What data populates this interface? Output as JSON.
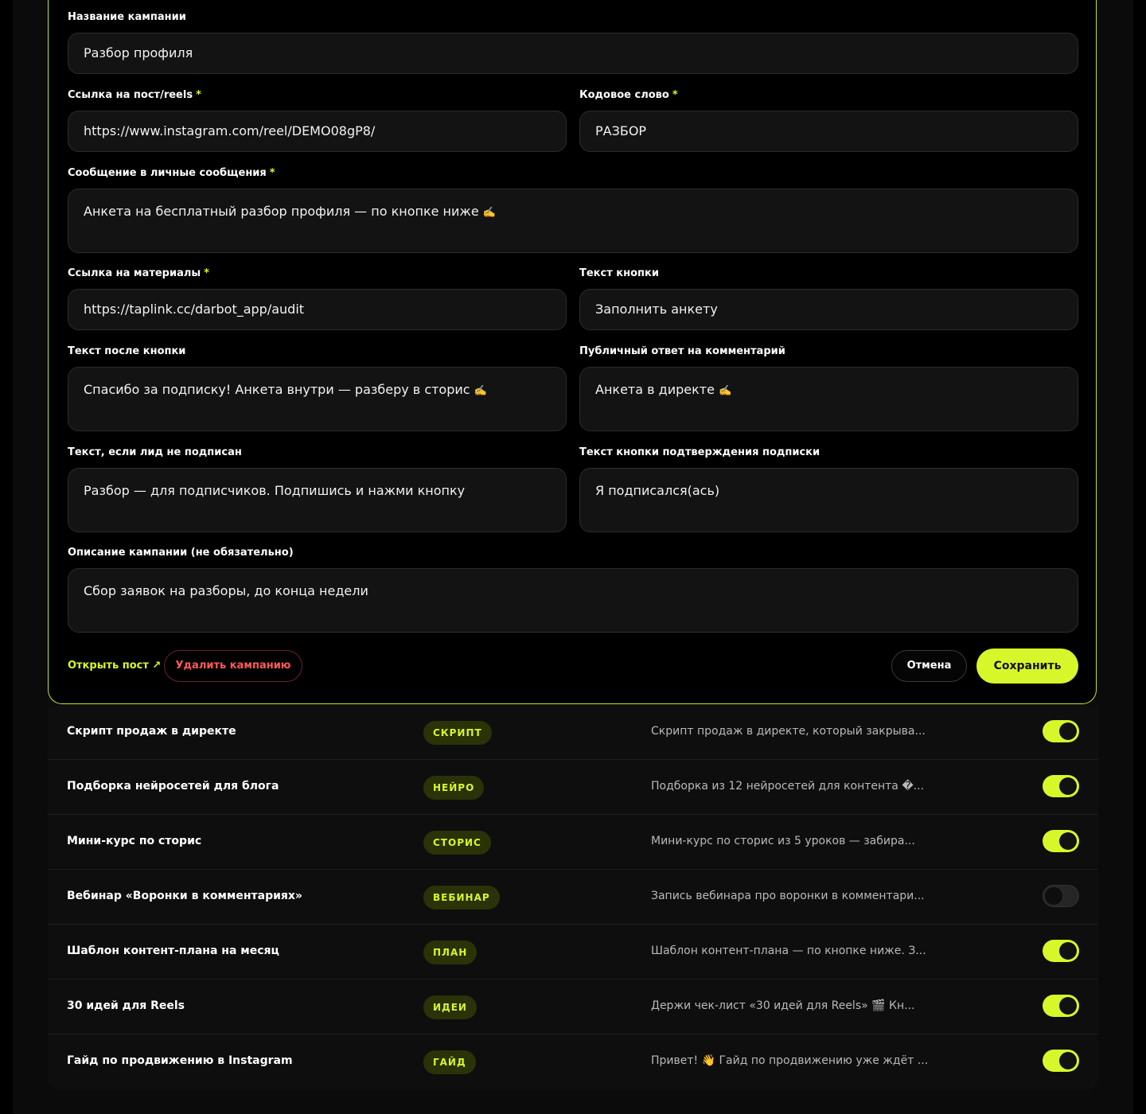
{
  "form": {
    "campaign_name": {
      "label": "Название кампании",
      "value": "Разбор профиля"
    },
    "post_link": {
      "label": "Ссылка на пост/reels",
      "required": "*",
      "value": "https://www.instagram.com/reel/DEMO08gP8/"
    },
    "code_word": {
      "label": "Кодовое слово",
      "required": "*",
      "value": "РАЗБОР"
    },
    "dm_message": {
      "label": "Сообщение в личные сообщения",
      "required": "*",
      "value": "Анкета на бесплатный разбор профиля — по кнопке ниже",
      "emoji": "✍️"
    },
    "materials_link": {
      "label": "Ссылка на материалы",
      "required": "*",
      "value": "https://taplink.cc/darbot_app/audit"
    },
    "button_text": {
      "label": "Текст кнопки",
      "value": "Заполнить анкету"
    },
    "after_button_text": {
      "label": "Текст после кнопки",
      "value": "Спасибо за подписку! Анкета внутри — разберу в сторис",
      "emoji": "✍️"
    },
    "public_reply": {
      "label": "Публичный ответ на комментарий",
      "value": "Анкета в директе",
      "emoji": "✍️"
    },
    "not_subscribed_text": {
      "label": "Текст, если лид не подписан",
      "value": "Разбор — для подписчиков. Подпишись и нажми кнопку"
    },
    "confirm_button_text": {
      "label": "Текст кнопки подтверждения подписки",
      "value": "Я подписался(ась)"
    },
    "description": {
      "label": "Описание кампании (не обязательно)",
      "value": "Сбор заявок на разборы, до конца недели"
    }
  },
  "actions": {
    "open_post": "Открыть пост ↗",
    "delete": "Удалить кампанию",
    "cancel": "Отмена",
    "save": "Сохранить"
  },
  "colors": {
    "accent": "#d8f72a",
    "danger": "#ff5a5a",
    "background": "#000000"
  },
  "campaigns": [
    {
      "title": "Скрипт продаж в директе",
      "tag": "СКРИПТ",
      "description": "Скрипт продаж в директе, который закрыва...",
      "enabled": true
    },
    {
      "title": "Подборка нейросетей для блога",
      "tag": "НЕЙРО",
      "description": "Подборка из 12 нейросетей для контента �...",
      "enabled": true
    },
    {
      "title": "Мини-курс по сторис",
      "tag": "СТОРИС",
      "description": "Мини-курс по сторис из 5 уроков — забира...",
      "enabled": true
    },
    {
      "title": "Вебинар «Воронки в комментариях»",
      "tag": "ВЕБИНАР",
      "description": "Запись вебинара про воронки в комментари...",
      "enabled": false
    },
    {
      "title": "Шаблон контент-плана на месяц",
      "tag": "ПЛАН",
      "description": "Шаблон контент-плана — по кнопке ниже. З...",
      "enabled": true
    },
    {
      "title": "30 идей для Reels",
      "tag": "ИДЕИ",
      "description": "Держи чек-лист «30 идей для Reels» 🎬 Кн...",
      "enabled": true
    },
    {
      "title": "Гайд по продвижению в Instagram",
      "tag": "ГАЙД",
      "description": "Привет! 👋 Гайд по продвижению уже ждёт ...",
      "enabled": true
    }
  ]
}
